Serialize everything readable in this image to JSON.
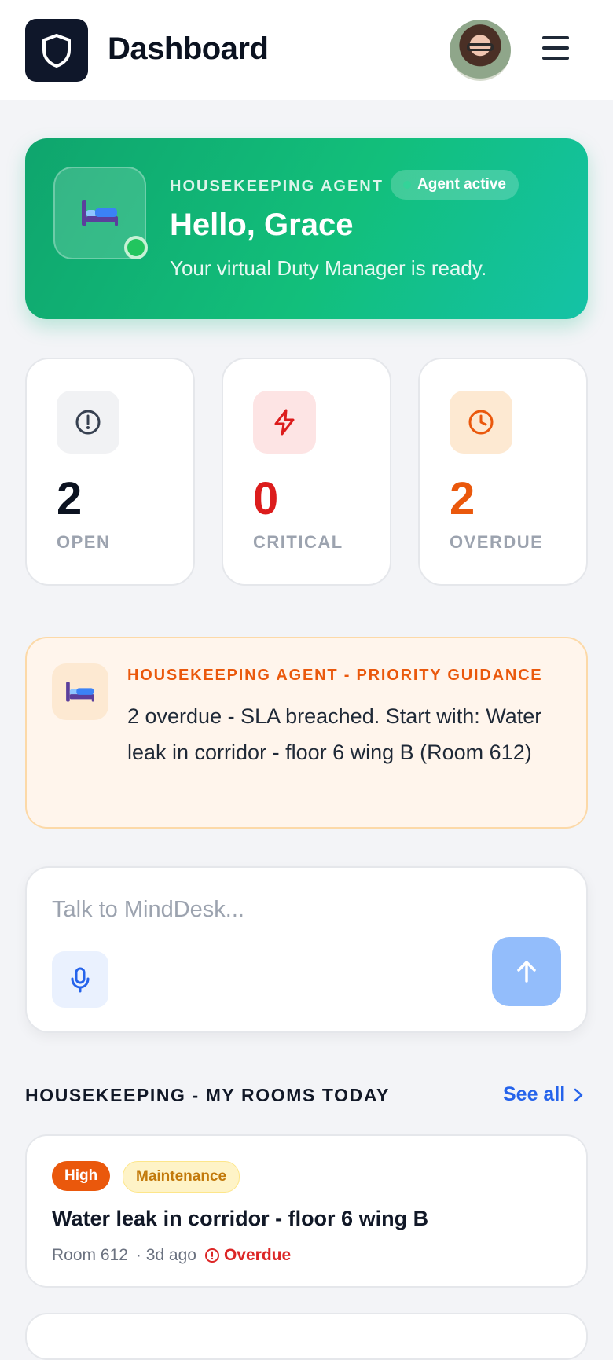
{
  "header": {
    "title": "Dashboard",
    "logo_icon": "shield-icon",
    "avatar_alt": "user avatar",
    "menu_icon": "hamburger-menu-icon"
  },
  "hero": {
    "kicker": "HOUSEKEEPING AGENT",
    "badge": "Agent active",
    "greeting": "Hello, Grace",
    "subtitle": "Your virtual Duty Manager is ready.",
    "icon": "bed-icon",
    "colors": {
      "start": "#0fa56d",
      "end": "#14c2a6"
    }
  },
  "stats": [
    {
      "value": "2",
      "label": "OPEN",
      "icon": "alert-circle-icon",
      "color": "#0b1220",
      "bg": "#f1f2f4"
    },
    {
      "value": "0",
      "label": "CRITICAL",
      "icon": "lightning-icon",
      "color": "#dc1c1c",
      "bg": "#fde4e4"
    },
    {
      "value": "2",
      "label": "OVERDUE",
      "icon": "clock-icon",
      "color": "#ea580c",
      "bg": "#fde9d2"
    }
  ],
  "guidance": {
    "kicker": "HOUSEKEEPING AGENT - PRIORITY GUIDANCE",
    "text": "2 overdue - SLA breached. Start with: Water leak in corridor - floor 6 wing B (Room 612)",
    "icon": "bed-icon"
  },
  "chat": {
    "placeholder": "Talk to MindDesk...",
    "value": "",
    "mic_icon": "microphone-icon",
    "send_icon": "arrow-up-icon"
  },
  "rooms": {
    "title": "HOUSEKEEPING - MY ROOMS TODAY",
    "see_all": "See all",
    "items": [
      {
        "priority": "High",
        "category": "Maintenance",
        "title": "Water leak in corridor - floor 6 wing B",
        "room": "Room 612",
        "age": "· 3d ago",
        "status": "Overdue"
      }
    ]
  }
}
